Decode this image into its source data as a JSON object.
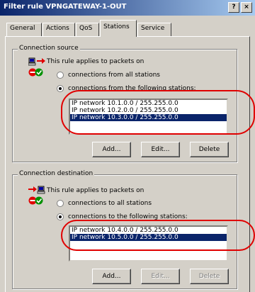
{
  "window": {
    "title": "Filter rule VPNGATEWAY-1-OUT",
    "help_button": "?",
    "close_button": "×"
  },
  "tabs": [
    {
      "label": "General"
    },
    {
      "label": "Actions"
    },
    {
      "label": "QoS"
    },
    {
      "label": "Stations",
      "active": true
    },
    {
      "label": "Service"
    }
  ],
  "source": {
    "group_label": "Connection source",
    "applies_text": "This rule applies to packets on",
    "option_all": "connections from all stations",
    "option_following": "connections from the following stations:",
    "selected_option": "following",
    "items": [
      {
        "text": "IP network 10.1.0.0 / 255.255.0.0",
        "selected": false
      },
      {
        "text": "IP network 10.2.0.0 / 255.255.0.0",
        "selected": false
      },
      {
        "text": "IP network 10.3.0.0 / 255.255.0.0",
        "selected": true
      }
    ],
    "buttons": {
      "add": "Add...",
      "edit": "Edit...",
      "delete": "Delete"
    }
  },
  "destination": {
    "group_label": "Connection destination",
    "applies_text": "This rule applies to packets on",
    "option_all": "connections to all stations",
    "option_following": "connections to the following stations:",
    "selected_option": "following",
    "items": [
      {
        "text": "IP network 10.4.0.0 / 255.255.0.0",
        "selected": false
      },
      {
        "text": "IP network 10.5.0.0 / 255.255.0.0",
        "selected": true
      }
    ],
    "buttons": {
      "add": "Add...",
      "edit": "Edit...",
      "delete": "Delete"
    },
    "edit_enabled": false,
    "delete_enabled": false
  },
  "colors": {
    "title_gradient_start": "#0a246a",
    "title_gradient_end": "#a6caf0",
    "selection": "#0a246a",
    "highlight_ring": "#e00000"
  }
}
